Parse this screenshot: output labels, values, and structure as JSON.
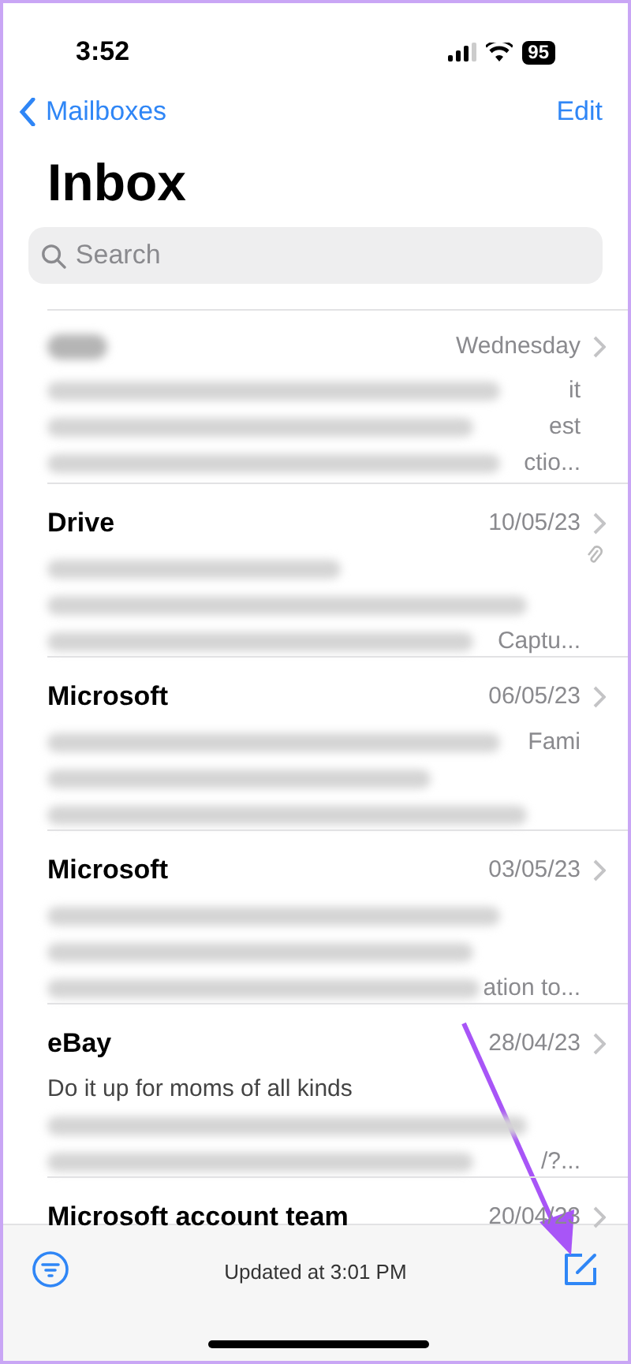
{
  "status_bar": {
    "time": "3:52",
    "battery": "95"
  },
  "nav": {
    "back": "Mailboxes",
    "action": "Edit"
  },
  "title": "Inbox",
  "search": {
    "placeholder": "Search"
  },
  "messages": [
    {
      "date": "Wednesday",
      "attachment": false,
      "lines": [
        {
          "kind": "blurred",
          "tail": "it"
        },
        {
          "kind": "blurred",
          "tail": "est"
        },
        {
          "kind": "blurred",
          "tail": "ctio..."
        }
      ]
    },
    {
      "sender": "Drive",
      "date": "10/05/23",
      "attachment": true,
      "lines": [
        {
          "kind": "blurred"
        },
        {
          "kind": "blurred"
        },
        {
          "kind": "blurred",
          "tail": "Captu..."
        }
      ]
    },
    {
      "sender": "Microsoft",
      "date": "06/05/23",
      "attachment": false,
      "lines": [
        {
          "kind": "blurred",
          "tail": "Fami"
        },
        {
          "kind": "blurred"
        },
        {
          "kind": "blurred"
        }
      ]
    },
    {
      "sender": "Microsoft",
      "date": "03/05/23",
      "attachment": false,
      "lines": [
        {
          "kind": "blurred"
        },
        {
          "kind": "blurred"
        },
        {
          "kind": "blurred",
          "tail": "ation to..."
        }
      ]
    },
    {
      "sender": "eBay",
      "date": "28/04/23",
      "attachment": false,
      "lines": [
        {
          "kind": "text",
          "text": "Do it up for moms of all kinds"
        },
        {
          "kind": "blurred"
        },
        {
          "kind": "blurred",
          "tail": "/?..."
        }
      ]
    },
    {
      "sender": "Microsoft account team",
      "date": "20/04/23"
    }
  ],
  "toolbar": {
    "status": "Updated at 3:01 PM"
  }
}
